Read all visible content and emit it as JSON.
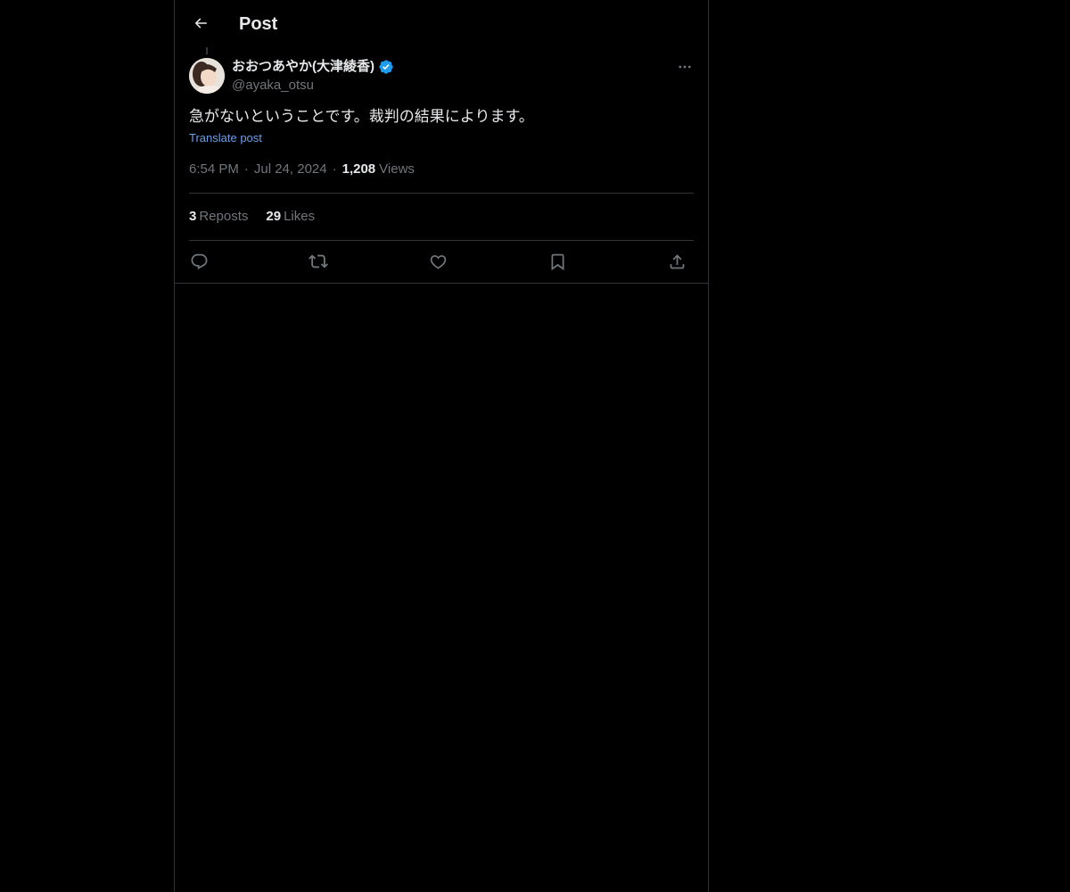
{
  "header": {
    "title": "Post",
    "back_icon": "arrow-left-icon"
  },
  "post": {
    "author": {
      "display_name": "おおつあやか(大津綾香)",
      "handle": "@ayaka_otsu",
      "verified_icon": "verified-badge-icon",
      "verified_color": "#1d9bf0"
    },
    "text": "急がないということです。裁判の結果によります。",
    "translate_label": "Translate post",
    "time": "6:54 PM",
    "date": "Jul 24, 2024",
    "views_count": "1,208",
    "views_label": "Views",
    "reposts_count": "3",
    "reposts_label": "Reposts",
    "likes_count": "29",
    "likes_label": "Likes"
  },
  "actions": [
    "reply-icon",
    "repost-icon",
    "like-icon",
    "bookmark-icon",
    "share-icon"
  ],
  "colors": {
    "background": "#000000",
    "text": "#e7e9ea",
    "secondary_text": "#71767b",
    "link": "#6d9eeb",
    "border": "#2f3336"
  }
}
